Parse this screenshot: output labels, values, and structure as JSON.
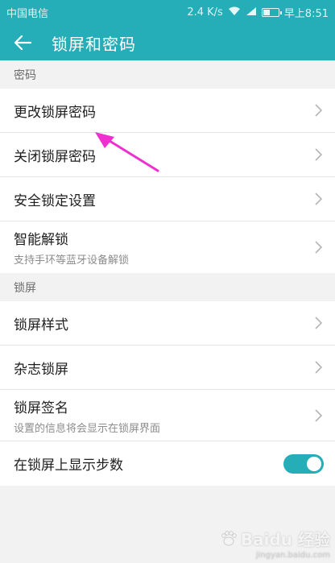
{
  "status_bar": {
    "carrier": "中国电信",
    "speed": "2.4 K/s",
    "time": "早上8:51",
    "icons": [
      "wifi-icon",
      "signal-icon",
      "battery-icon"
    ]
  },
  "app_bar": {
    "back_icon": "back-arrow-icon",
    "title": "锁屏和密码"
  },
  "sections": {
    "password": {
      "header": "密码",
      "items": [
        {
          "label": "更改锁屏密码"
        },
        {
          "label": "关闭锁屏密码"
        },
        {
          "label": "安全锁定设置"
        },
        {
          "label": "智能解锁",
          "sub": "支持手环等蓝牙设备解锁"
        }
      ]
    },
    "lockscreen": {
      "header": "锁屏",
      "items": [
        {
          "label": "锁屏样式"
        },
        {
          "label": "杂志锁屏"
        },
        {
          "label": "锁屏签名",
          "sub": "设置的信息将会显示在锁屏界面"
        },
        {
          "label": "在锁屏上显示步数",
          "toggle_on": true
        }
      ]
    }
  },
  "annotation": {
    "color": "#f02fd0"
  },
  "watermark": {
    "brand": "Baidu 经验",
    "url": "jingyan.baidu.com"
  },
  "colors": {
    "accent": "#25aeb8"
  }
}
